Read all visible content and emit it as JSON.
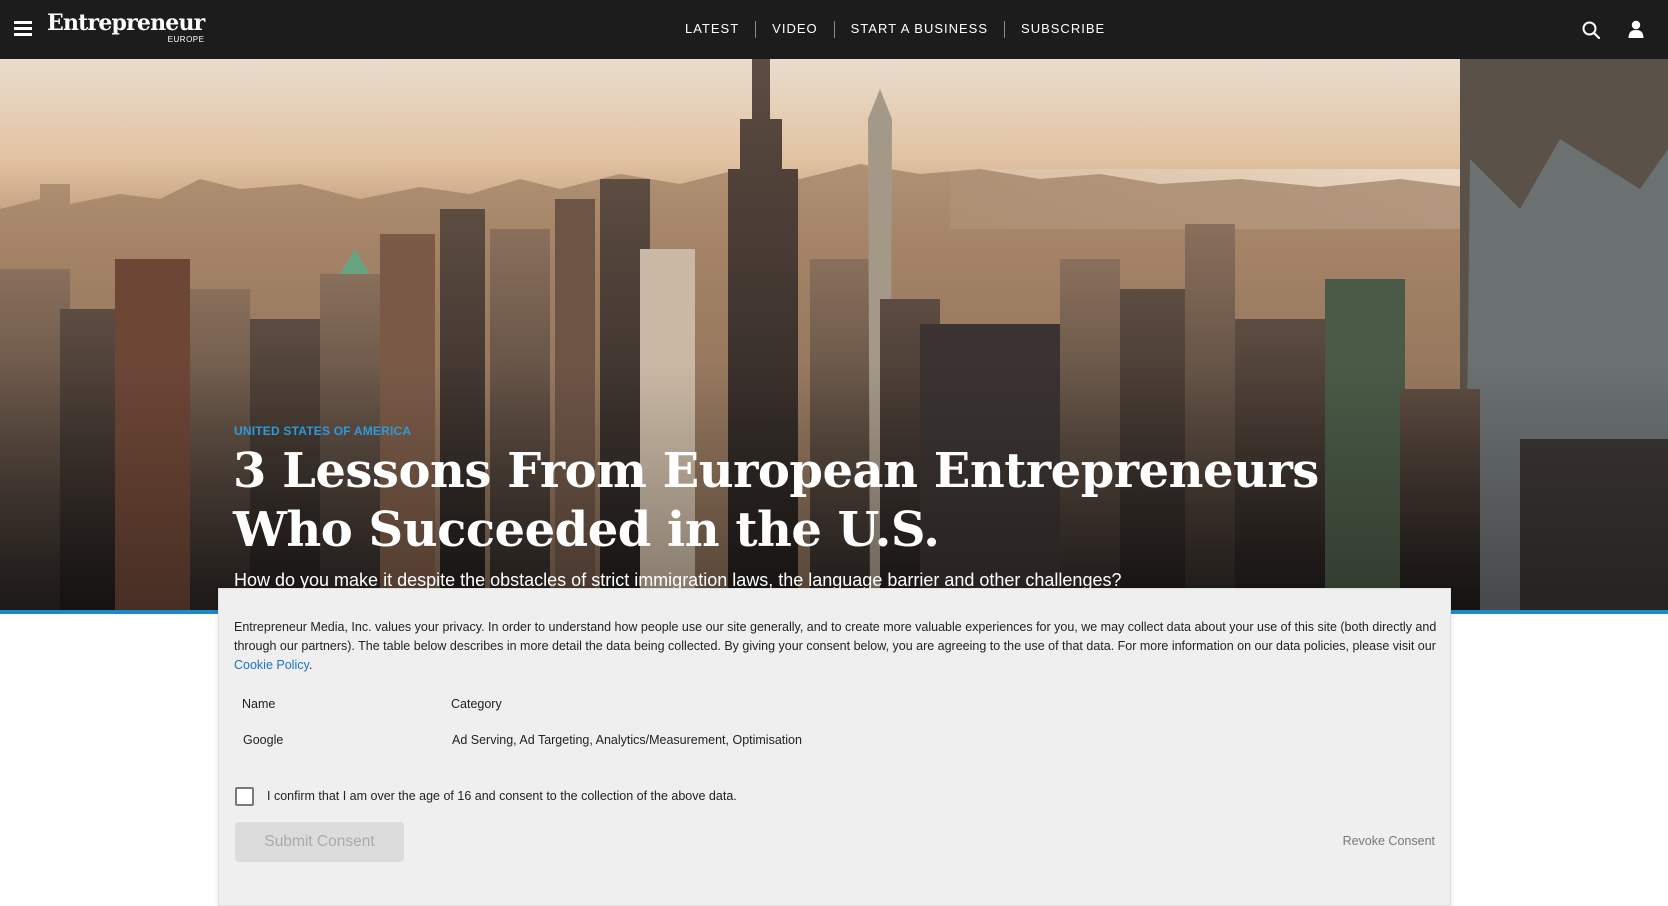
{
  "header": {
    "logo_text": "Entrepreneur",
    "logo_sub": "EUROPE",
    "nav": [
      "LATEST",
      "VIDEO",
      "START A BUSINESS",
      "SUBSCRIBE"
    ],
    "icons": [
      "menu-icon",
      "search-icon",
      "user-icon"
    ]
  },
  "article": {
    "category": "UNITED STATES OF AMERICA",
    "title": "3 Lessons From European Entrepreneurs Who Succeeded in the U.S.",
    "subtitle": "How do you make it despite the obstacles of strict immigration laws, the language barrier and other challenges?"
  },
  "consent": {
    "intro": "Entrepreneur Media, Inc. values your privacy. In order to understand how people use our site generally, and to create more valuable experiences for you, we may collect data about your use of this site (both directly and through our partners). The table below describes in more detail the data being collected. By giving your consent below, you are agreeing to the use of that data. For more information on our data policies, please visit our",
    "link_text": "Cookie Policy",
    "after_link": ".",
    "table_headers": [
      "Name",
      "Category"
    ],
    "table_rows": [
      [
        "Google",
        "Ad Serving, Ad Targeting, Analytics/Measurement, Optimisation"
      ]
    ],
    "checkbox_label": "I confirm that I am over the age of 16 and consent to the collection of the above data.",
    "submit_label": "Submit Consent",
    "revoke_label": "Revoke Consent"
  },
  "colors": {
    "topbar": "#1c1c1c",
    "accent": "#1e88c8",
    "category": "#2e9ad8",
    "link": "#1a73c4"
  }
}
